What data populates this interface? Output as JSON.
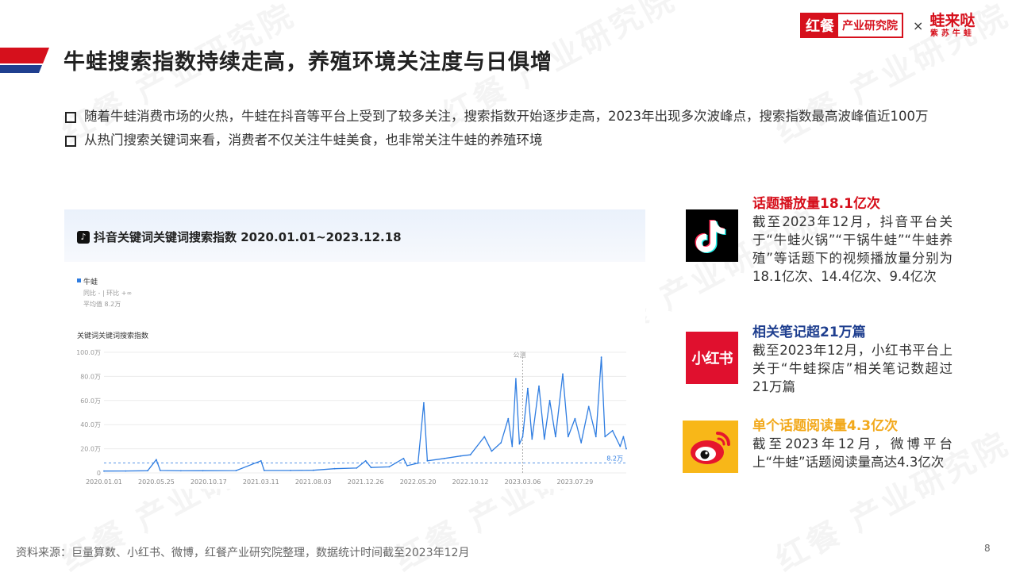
{
  "header": {
    "title": "牛蛙搜索指数持续走高，养殖环境关注度与日俱增",
    "logo": {
      "short": "红餐",
      "institute": "产业研究院",
      "times": "×",
      "partner_top": "蛙来哒",
      "partner_bottom": "紫苏牛蛙"
    }
  },
  "bullets": [
    "随着牛蛙消费市场的火热，牛蛙在抖音等平台上受到了较多关注，搜索指数开始逐步走高，2023年出现多次波峰点，搜索指数最高波峰值近100万",
    "从热门搜索关键词来看，消费者不仅关注牛蛙美食，也非常关注牛蛙的养殖环境"
  ],
  "chart_panel": {
    "title": "抖音关键词关键词搜索指数 2020.01.01~2023.12.18",
    "legend_name": "牛蛙",
    "legend_stats": "同比 - | 环比 +∞",
    "legend_avg": "平均值 8.2万",
    "subtitle": "关键词关键词搜索指数"
  },
  "chart_data": {
    "type": "line",
    "title": "抖音关键词关键词搜索指数 2020.01.01~2023.12.18",
    "ylabel": "关键词关键词搜索指数",
    "y_ticks": [
      "100.0万",
      "80.0万",
      "60.0万",
      "40.0万",
      "20.0万",
      "0"
    ],
    "ylim": [
      0,
      100
    ],
    "x_ticks": [
      "2020.01.01",
      "2020.05.25",
      "2020.10.17",
      "2021.03.11",
      "2021.08.03",
      "2021.12.26",
      "2022.05.20",
      "2022.10.12",
      "2023.03.06",
      "2023.07.29"
    ],
    "average_line": {
      "value": 8.2,
      "label": "8.2万"
    },
    "marker": {
      "label": "公测",
      "date": "2023.03.06"
    },
    "color": "#2f7de1",
    "series": [
      {
        "name": "牛蛙",
        "unit": "万",
        "points": [
          [
            "2020.01.01",
            1.5
          ],
          [
            "2020.03.01",
            1.6
          ],
          [
            "2020.05.01",
            1.8
          ],
          [
            "2020.05.25",
            11
          ],
          [
            "2020.06.05",
            2.0
          ],
          [
            "2020.08.01",
            1.7
          ],
          [
            "2020.10.01",
            1.8
          ],
          [
            "2021.01.01",
            1.9
          ],
          [
            "2021.03.11",
            10
          ],
          [
            "2021.03.20",
            2.0
          ],
          [
            "2021.06.01",
            2.0
          ],
          [
            "2021.08.03",
            2.2
          ],
          [
            "2021.10.01",
            3.5
          ],
          [
            "2021.12.01",
            4.0
          ],
          [
            "2021.12.26",
            10
          ],
          [
            "2022.01.10",
            4.5
          ],
          [
            "2022.03.01",
            5.0
          ],
          [
            "2022.04.10",
            12
          ],
          [
            "2022.04.20",
            6.0
          ],
          [
            "2022.05.20",
            8.0
          ],
          [
            "2022.06.05",
            58
          ],
          [
            "2022.06.15",
            10
          ],
          [
            "2022.08.01",
            12
          ],
          [
            "2022.09.15",
            14
          ],
          [
            "2022.10.12",
            15
          ],
          [
            "2022.11.20",
            30
          ],
          [
            "2022.12.10",
            18
          ],
          [
            "2023.01.05",
            25
          ],
          [
            "2023.01.25",
            45
          ],
          [
            "2023.02.05",
            22
          ],
          [
            "2023.02.15",
            78
          ],
          [
            "2023.02.25",
            24
          ],
          [
            "2023.03.06",
            30
          ],
          [
            "2023.03.20",
            70
          ],
          [
            "2023.04.01",
            28
          ],
          [
            "2023.04.20",
            72
          ],
          [
            "2023.05.05",
            28
          ],
          [
            "2023.05.20",
            60
          ],
          [
            "2023.06.05",
            30
          ],
          [
            "2023.06.25",
            82
          ],
          [
            "2023.07.10",
            30
          ],
          [
            "2023.07.29",
            45
          ],
          [
            "2023.08.15",
            25
          ],
          [
            "2023.09.05",
            55
          ],
          [
            "2023.09.25",
            30
          ],
          [
            "2023.10.10",
            96
          ],
          [
            "2023.10.20",
            30
          ],
          [
            "2023.11.10",
            35
          ],
          [
            "2023.12.01",
            22
          ],
          [
            "2023.12.10",
            30
          ],
          [
            "2023.12.18",
            20
          ]
        ]
      }
    ]
  },
  "side": [
    {
      "icon": "tiktok-icon",
      "head": "话题播放量18.1亿次",
      "head_color": "#d6101c",
      "text": "截至2023年12月，抖音平台关于“牛蛙火锅”“干锅牛蛙”“牛蛙养殖”等话题下的视频播放量分别为18.1亿次、14.4亿次、9.4亿次"
    },
    {
      "icon": "xiaohongshu-icon",
      "icon_text": "小红书",
      "head": "相关笔记超21万篇",
      "head_color": "#1f3f8f",
      "text": "截至2023年12月，小红书平台上关于“牛蛙探店”相关笔记数超过21万篇"
    },
    {
      "icon": "weibo-icon",
      "head": "单个话题阅读量4.3亿次",
      "head_color": "#f2a91c",
      "text": "截至2023年12月，微博平台上“牛蛙”话题阅读量高达4.3亿次"
    }
  ],
  "footer": {
    "source": "资料来源：巨量算数、小红书、微博，红餐产业研究院整理，数据统计时间截至2023年12月",
    "page_number": "8"
  },
  "colors": {
    "brand_red": "#d6101c",
    "navy": "#1f3f8f",
    "orange": "#f2a91c",
    "line_blue": "#2f7de1"
  }
}
